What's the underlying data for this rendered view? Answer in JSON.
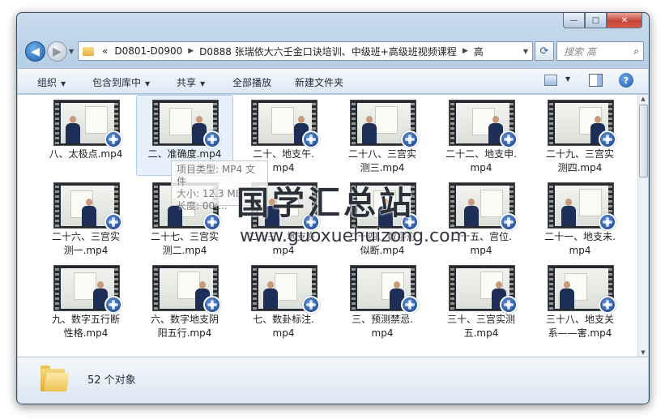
{
  "window": {
    "caption_buttons": {
      "minimize": "—",
      "maximize": "□",
      "close": "✕"
    }
  },
  "address": {
    "overflow_marker": "«",
    "crumbs": [
      "D0801-D0900",
      "D0888 张瑞依大六壬金口诀培训、中级班+高级班视频课程",
      "高"
    ],
    "search_placeholder": "搜索 高"
  },
  "toolbar": {
    "organize": "组织",
    "include_in_library": "包含到库中",
    "share": "共享",
    "play_all": "全部播放",
    "new_folder": "新建文件夹"
  },
  "tooltip": {
    "lines": [
      "项目类型: MP4 文件",
      "大小: 12.3 MB",
      "长度: 00:..."
    ]
  },
  "watermark": {
    "title": "国学汇总站",
    "url": "www.guoxuehuizong.com"
  },
  "files": [
    {
      "line1": "八、太极点.mp4",
      "line2": ""
    },
    {
      "line1": "二、准确度.mp4",
      "line2": ""
    },
    {
      "line1": "二十、地支午.",
      "line2": "mp4"
    },
    {
      "line1": "二十八、三宫实",
      "line2": "测三.mp4"
    },
    {
      "line1": "二十二、地支申.",
      "line2": "mp4"
    },
    {
      "line1": "二十九、三宫实",
      "line2": "测四.mp4"
    },
    {
      "line1": "二十六、三宫实",
      "line2": "测一.mp4"
    },
    {
      "line1": "二十七、三宫实",
      "line2": "测二.mp4"
    },
    {
      "line1": "二十三、地支亥.",
      "line2": "mp4"
    },
    {
      "line1": "二十四、数字形",
      "line2": "似断.mp4"
    },
    {
      "line1": "二十五、宫位.",
      "line2": "mp4"
    },
    {
      "line1": "二十一、地支未.",
      "line2": "mp4"
    },
    {
      "line1": "九、数字五行断",
      "line2": "性格.mp4"
    },
    {
      "line1": "六、数字地支阴",
      "line2": "阳五行.mp4"
    },
    {
      "line1": "七、数卦标注.",
      "line2": "mp4"
    },
    {
      "line1": "三、预测禁忌.",
      "line2": "mp4"
    },
    {
      "line1": "三十、三宫实测",
      "line2": "五.mp4"
    },
    {
      "line1": "三十八、地支关",
      "line2": "系——害.mp4"
    }
  ],
  "status": {
    "count": "52 个对象"
  },
  "icons": {
    "back": "back-arrow-icon",
    "forward": "forward-arrow-icon",
    "refresh": "refresh-icon",
    "search": "search-icon",
    "help": "help-icon",
    "video_badge": "video-reel-icon"
  },
  "colors": {
    "accent": "#1f5fae",
    "selection": "#e6f1fc",
    "toolbar": "#dde8f4"
  }
}
